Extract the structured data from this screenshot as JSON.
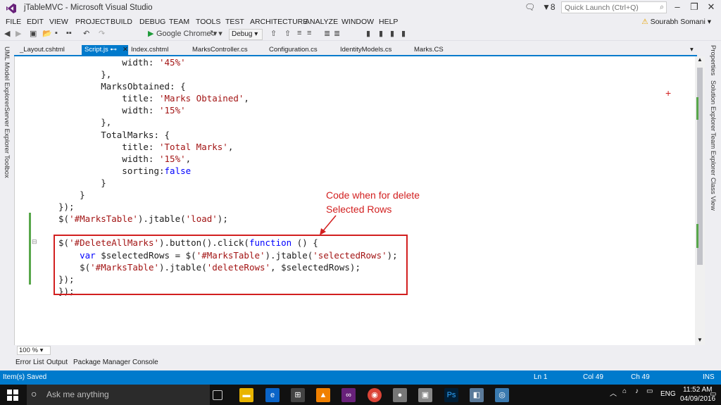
{
  "window": {
    "title": "jTableMVC - Microsoft Visual Studio",
    "notifications": "8",
    "quick_launch_placeholder": "Quick Launch (Ctrl+Q)"
  },
  "menu": [
    "FILE",
    "EDIT",
    "VIEW",
    "PROJECT",
    "BUILD",
    "DEBUG",
    "TEAM",
    "TOOLS",
    "TEST",
    "ARCHITECTURE",
    "ANALYZE",
    "WINDOW",
    "HELP"
  ],
  "user": "Sourabh Somani",
  "toolbar": {
    "browser": "Google Chrome",
    "config": "Debug"
  },
  "tabs": [
    "_Layout.cshtml",
    "Script.js",
    "Index.cshtml",
    "MarksController.cs",
    "Configuration.cs",
    "IdentityModels.cs",
    "Marks.CS"
  ],
  "tabs_pin": "⊷",
  "tabs_close": "✕",
  "left_panels": [
    "UML Model Explorer",
    "Server Explorer",
    "Toolbox"
  ],
  "right_panels": [
    "Properties",
    "Solution Explorer",
    "Team Explorer",
    "Class View"
  ],
  "code_lines": [
    [
      {
        "t": "            width: "
      },
      {
        "t": "'45%'",
        "c": "str"
      }
    ],
    [
      {
        "t": "        },"
      }
    ],
    [
      {
        "t": "        MarksObtained: {"
      }
    ],
    [
      {
        "t": "            title: "
      },
      {
        "t": "'Marks Obtained'",
        "c": "str"
      },
      {
        "t": ","
      }
    ],
    [
      {
        "t": "            width: "
      },
      {
        "t": "'15%'",
        "c": "str"
      }
    ],
    [
      {
        "t": "        },"
      }
    ],
    [
      {
        "t": "        TotalMarks: {"
      }
    ],
    [
      {
        "t": "            title: "
      },
      {
        "t": "'Total Marks'",
        "c": "str"
      },
      {
        "t": ","
      }
    ],
    [
      {
        "t": "            width: "
      },
      {
        "t": "'15%'",
        "c": "str"
      },
      {
        "t": ","
      }
    ],
    [
      {
        "t": "            sorting:"
      },
      {
        "t": "false",
        "c": "kw"
      }
    ],
    [
      {
        "t": "        }"
      }
    ],
    [
      {
        "t": "    }"
      }
    ],
    [
      {
        "t": "});"
      }
    ],
    [
      {
        "t": "$("
      },
      {
        "t": "'#MarksTable'",
        "c": "str"
      },
      {
        "t": ").jtable("
      },
      {
        "t": "'load'",
        "c": "str"
      },
      {
        "t": ");"
      }
    ],
    [
      {
        "t": ""
      }
    ],
    [
      {
        "t": "$("
      },
      {
        "t": "'#DeleteAllMarks'",
        "c": "str"
      },
      {
        "t": ").button().click("
      },
      {
        "t": "function",
        "c": "kw"
      },
      {
        "t": " () {"
      }
    ],
    [
      {
        "t": "    "
      },
      {
        "t": "var",
        "c": "kw"
      },
      {
        "t": " $selectedRows = $("
      },
      {
        "t": "'#MarksTable'",
        "c": "str"
      },
      {
        "t": ").jtable("
      },
      {
        "t": "'selectedRows'",
        "c": "str"
      },
      {
        "t": ");"
      }
    ],
    [
      {
        "t": "    $("
      },
      {
        "t": "'#MarksTable'",
        "c": "str"
      },
      {
        "t": ").jtable("
      },
      {
        "t": "'deleteRows'",
        "c": "str"
      },
      {
        "t": ", $selectedRows);"
      }
    ],
    [
      {
        "t": "});"
      }
    ],
    [
      {
        "t": "});"
      }
    ]
  ],
  "annotation": "Code when for delete\nSelected Rows",
  "zoom": "100 %",
  "bottom_tabs": [
    "Error List",
    "Output",
    "Package Manager Console"
  ],
  "status": {
    "message": "Item(s) Saved",
    "ln": "Ln 1",
    "col": "Col 49",
    "ch": "Ch 49",
    "mode": "INS"
  },
  "taskbar": {
    "search": "Ask me anything",
    "lang": "ENG",
    "time": "11:52 AM",
    "date": "04/09/2016"
  },
  "colors": {
    "accent": "#007acc",
    "annotation": "#d21f1f",
    "string": "#a31515",
    "keyword": "#0000ff"
  }
}
